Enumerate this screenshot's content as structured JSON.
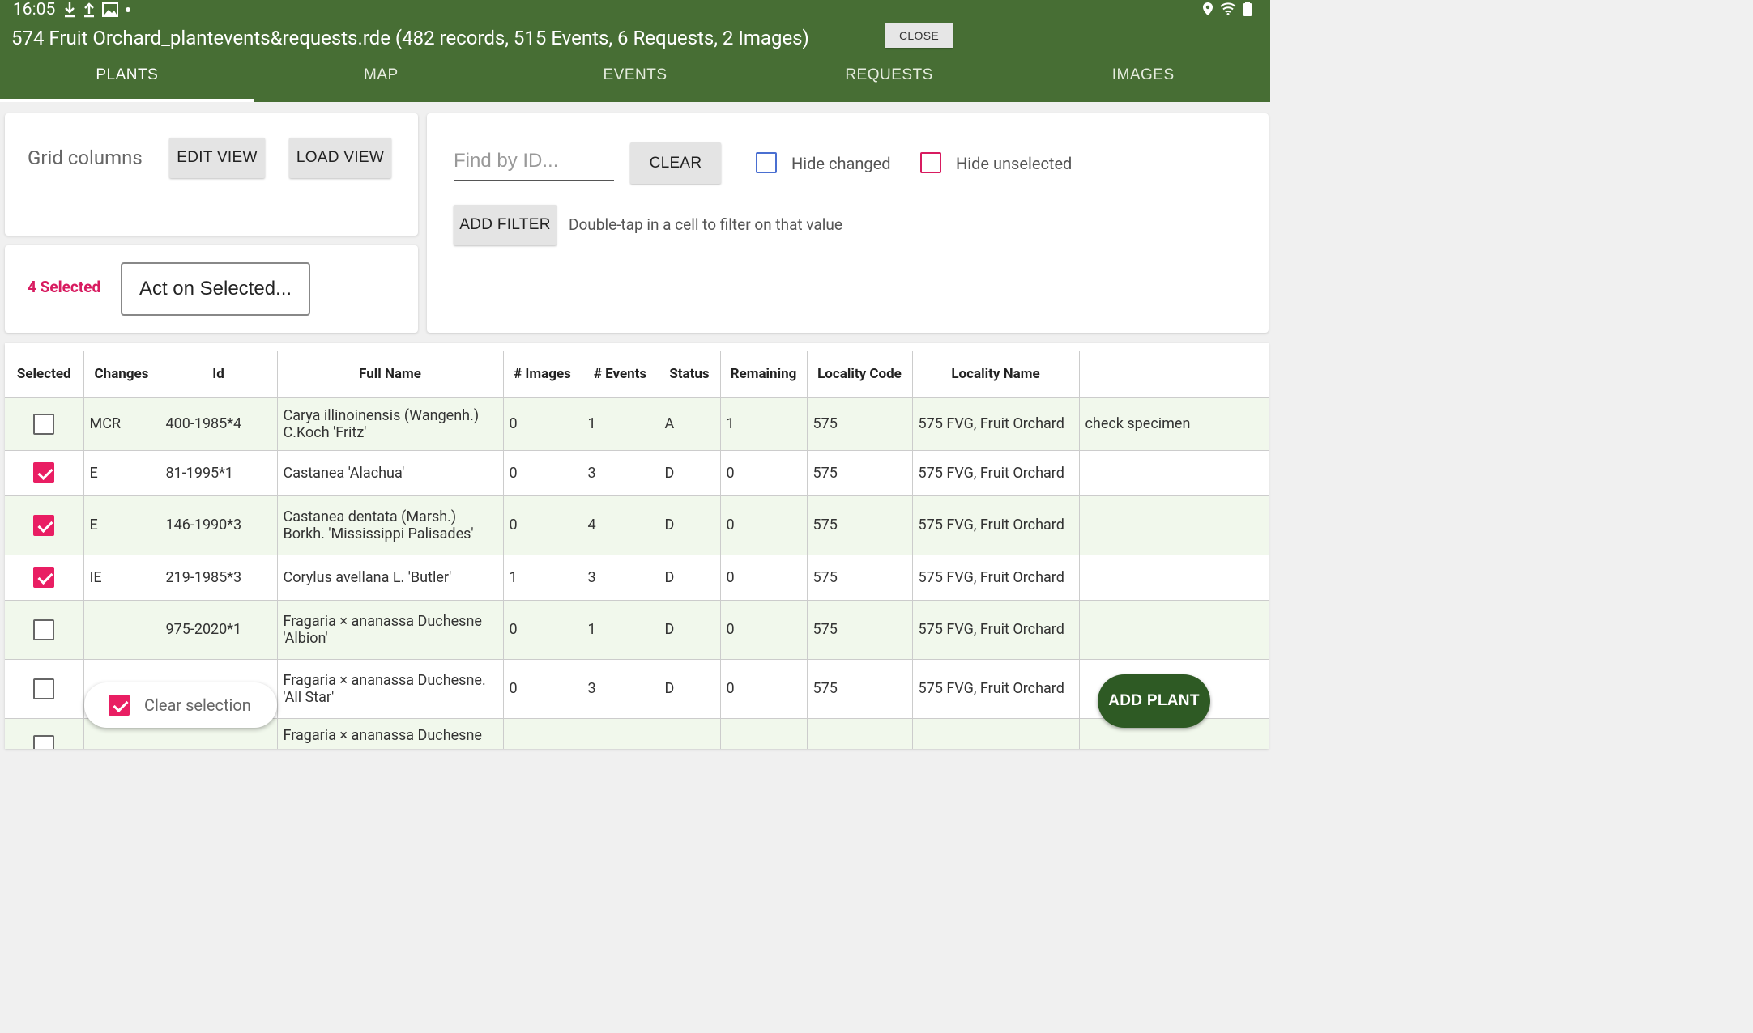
{
  "status_bar": {
    "time": "16:05"
  },
  "window": {
    "title": "574 Fruit Orchard_plantevents&requests.rde (482 records, 515 Events, 6 Requests, 2 Images)",
    "close_label": "CLOSE"
  },
  "tabs": [
    {
      "label": "PLANTS",
      "active": true
    },
    {
      "label": "MAP"
    },
    {
      "label": "EVENTS"
    },
    {
      "label": "REQUESTS"
    },
    {
      "label": "IMAGES"
    }
  ],
  "grid_panel": {
    "label": "Grid columns",
    "edit_view": "EDIT VIEW",
    "load_view": "LOAD VIEW"
  },
  "selection_panel": {
    "count_label": "4 Selected",
    "act_label": "Act on Selected..."
  },
  "filter_panel": {
    "find_placeholder": "Find by ID...",
    "clear_label": "CLEAR",
    "hide_changed": "Hide changed",
    "hide_unselected": "Hide unselected",
    "add_filter": "ADD FILTER",
    "hint": "Double-tap in a cell to filter on that value"
  },
  "table": {
    "headers": [
      "Selected",
      "Changes",
      "Id",
      "Full Name",
      "# Images",
      "# Events",
      "Status",
      "Remaining",
      "Locality Code",
      "Locality Name",
      ""
    ],
    "rows": [
      {
        "selected": false,
        "changes": "MCR",
        "id": "400-1985*4",
        "full_name": "Carya illinoinensis (Wangenh.) C.Koch 'Fritz'",
        "images": "0",
        "events": "1",
        "status": "A",
        "remaining": "1",
        "locality_code": "575",
        "locality_name": "575 FVG, Fruit Orchard",
        "note": "check specimen"
      },
      {
        "selected": true,
        "changes": "E",
        "id": "81-1995*1",
        "full_name": "Castanea 'Alachua'",
        "images": "0",
        "events": "3",
        "status": "D",
        "remaining": "0",
        "locality_code": "575",
        "locality_name": "575 FVG, Fruit Orchard",
        "note": ""
      },
      {
        "selected": true,
        "changes": "E",
        "id": "146-1990*3",
        "full_name": "Castanea dentata (Marsh.) Borkh. 'Mississippi Palisades'",
        "images": "0",
        "events": "4",
        "status": "D",
        "remaining": "0",
        "locality_code": "575",
        "locality_name": "575 FVG, Fruit Orchard",
        "note": ""
      },
      {
        "selected": true,
        "changes": "IE",
        "id": "219-1985*3",
        "full_name": "Corylus avellana L. 'Butler'",
        "images": "1",
        "events": "3",
        "status": "D",
        "remaining": "0",
        "locality_code": "575",
        "locality_name": "575 FVG, Fruit Orchard",
        "note": ""
      },
      {
        "selected": false,
        "changes": "",
        "id": "975-2020*1",
        "full_name": "Fragaria × ananassa Duchesne 'Albion'",
        "images": "0",
        "events": "1",
        "status": "D",
        "remaining": "0",
        "locality_code": "575",
        "locality_name": "575 FVG, Fruit Orchard",
        "note": ""
      },
      {
        "selected": false,
        "changes": "",
        "id": "",
        "full_name": "Fragaria × ananassa Duchesne. 'All Star'",
        "images": "0",
        "events": "3",
        "status": "D",
        "remaining": "0",
        "locality_code": "575",
        "locality_name": "575 FVG, Fruit Orchard",
        "note": ""
      },
      {
        "selected": false,
        "changes": "",
        "id": "",
        "full_name": "Fragaria × ananassa Duchesne",
        "images": "",
        "events": "",
        "status": "",
        "remaining": "",
        "locality_code": "",
        "locality_name": "",
        "note": ""
      }
    ]
  },
  "floating": {
    "clear_selection": "Clear selection",
    "add_plant": "ADD PLANT"
  },
  "colors": {
    "header": "#476e34",
    "accent_pink": "#e91e63",
    "row_tint": "#f1f8ec",
    "fab": "#2e5a24"
  }
}
